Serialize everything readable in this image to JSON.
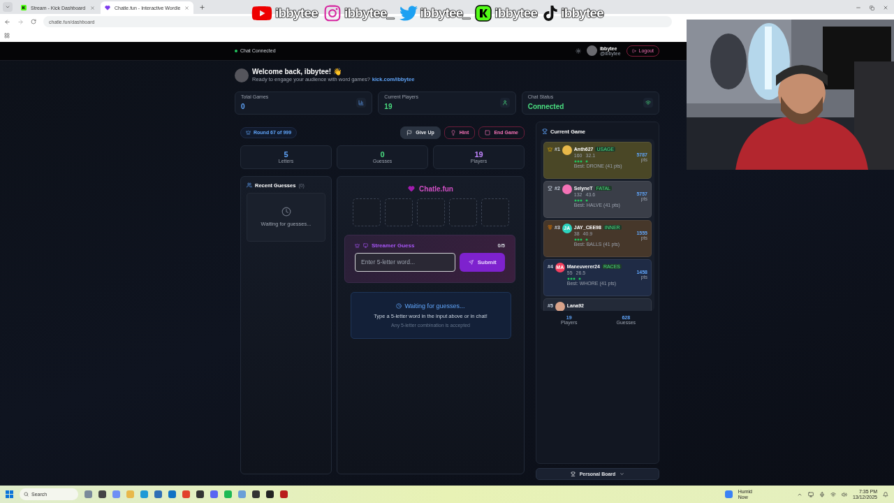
{
  "browser": {
    "tabs": [
      {
        "title": "Stream - Kick Dashboard",
        "selected": false,
        "kind": "kick"
      },
      {
        "title": "Chatle.fun - Interactive Wordle",
        "selected": true,
        "kind": "chatle"
      }
    ],
    "url": "chatle.fun/dashboard"
  },
  "overlay": {
    "handles": [
      {
        "kind": "youtube",
        "handle": "ibbytee"
      },
      {
        "kind": "instagram",
        "handle": "ibbytee_"
      },
      {
        "kind": "twitter",
        "handle": "ibbytee_"
      },
      {
        "kind": "kick",
        "handle": "ibbytee"
      },
      {
        "kind": "tiktok",
        "handle": "ibbytee"
      }
    ]
  },
  "header": {
    "status": "Chat Connected",
    "connected": true,
    "user_name": "ibbytee",
    "user_handle": "@ibbytee",
    "logout": "Logout"
  },
  "welcome": {
    "title": "Welcome back, ibbytee! 👋",
    "subtitle": "Ready to engage your audience with word games?",
    "link": "kick.com/ibbytee"
  },
  "stats": [
    {
      "kind": "chart",
      "label": "Total Games",
      "value": "0",
      "color": "#60a5fa"
    },
    {
      "kind": "user",
      "label": "Current Players",
      "value": "19",
      "color": "#4ade80"
    },
    {
      "kind": "wifi",
      "label": "Chat Status",
      "value": "Connected",
      "color": "#4ade80"
    }
  ],
  "round": "Round 67 of 999",
  "actions": [
    {
      "kind": "flag",
      "label": "Give Up"
    },
    {
      "kind": "bulb",
      "label": "Hint"
    },
    {
      "kind": "square",
      "label": "End Game"
    }
  ],
  "counters": [
    {
      "value": "5",
      "label": "Letters",
      "color": "#60a5fa"
    },
    {
      "value": "0",
      "label": "Guesses",
      "color": "#4ade80"
    },
    {
      "value": "19",
      "label": "Players",
      "color": "#c084fc"
    }
  ],
  "recent": {
    "title": "Recent Guesses",
    "count": "(0)",
    "empty": "Waiting for guesses..."
  },
  "game": {
    "brand": "Chatle.fun",
    "tiles": [
      {
        "filled": false
      },
      {
        "filled": false
      },
      {
        "filled": false
      },
      {
        "filled": false
      },
      {
        "filled": false
      }
    ],
    "streamer_guess": {
      "title": "Streamer Guess",
      "count": "0/5",
      "placeholder": "Enter 5-letter word...",
      "submit": "Submit"
    },
    "waiting": {
      "title": "Waiting for guesses...",
      "text": "Type a 5-letter word in the input above or in chat!",
      "hint": "Any 5-letter combination is accepted"
    }
  },
  "current_game": {
    "title": "Current Game",
    "players": [
      {
        "kind": "crown",
        "rank": "#1",
        "name": "Anth627",
        "word": "USAGE",
        "points": "160",
        "average": "32.1",
        "best": "Best: DRONE (41 pts)",
        "score": "5787",
        "unit": "pts",
        "color": "#4a4726",
        "avatar": {
          "color": "#e9b949"
        }
      },
      {
        "kind": "trophy",
        "rank": "#2",
        "name": "SelyneT",
        "word": "FATAL",
        "points": "132",
        "average": "43.6",
        "best": "Best: HALVE (41 pts)",
        "score": "5757",
        "unit": "pts",
        "color": "#3a3e48",
        "avatar": {
          "color": "#f472b6"
        }
      },
      {
        "kind": "medal",
        "rank": "#3",
        "name": "JAY_CEE98",
        "word": "INNER",
        "points": "38",
        "average": "40.9",
        "best": "Best: BALLS (41 pts)",
        "score": "1555",
        "unit": "pts",
        "color": "#46372a",
        "avatar": {
          "color": "#2dd4bf",
          "initials": "JA"
        }
      },
      {
        "kind": "plain",
        "rank": "#4",
        "name": "Maneuverer24",
        "word": "RACES",
        "points": "55",
        "average": "26.5",
        "best": "Best: WHORE (41 pts)",
        "score": "1458",
        "unit": "pts",
        "color": "#1f2b45",
        "avatar": {
          "color": "#f43f5e",
          "initials": "MA"
        }
      },
      {
        "kind": "plain",
        "rank": "#5",
        "name": "Lana92",
        "color": "#232a38",
        "avatar": {
          "color": "#d9a38a"
        }
      }
    ],
    "footer": [
      {
        "value": "19",
        "label": "Players"
      },
      {
        "value": "628",
        "label": "Guesses"
      }
    ],
    "personal_board": "Personal Board"
  },
  "taskbar": {
    "search": "Search",
    "weather": "Humid",
    "weather_time": "Now",
    "time": "7:35 PM",
    "date": "13/12/2025"
  }
}
